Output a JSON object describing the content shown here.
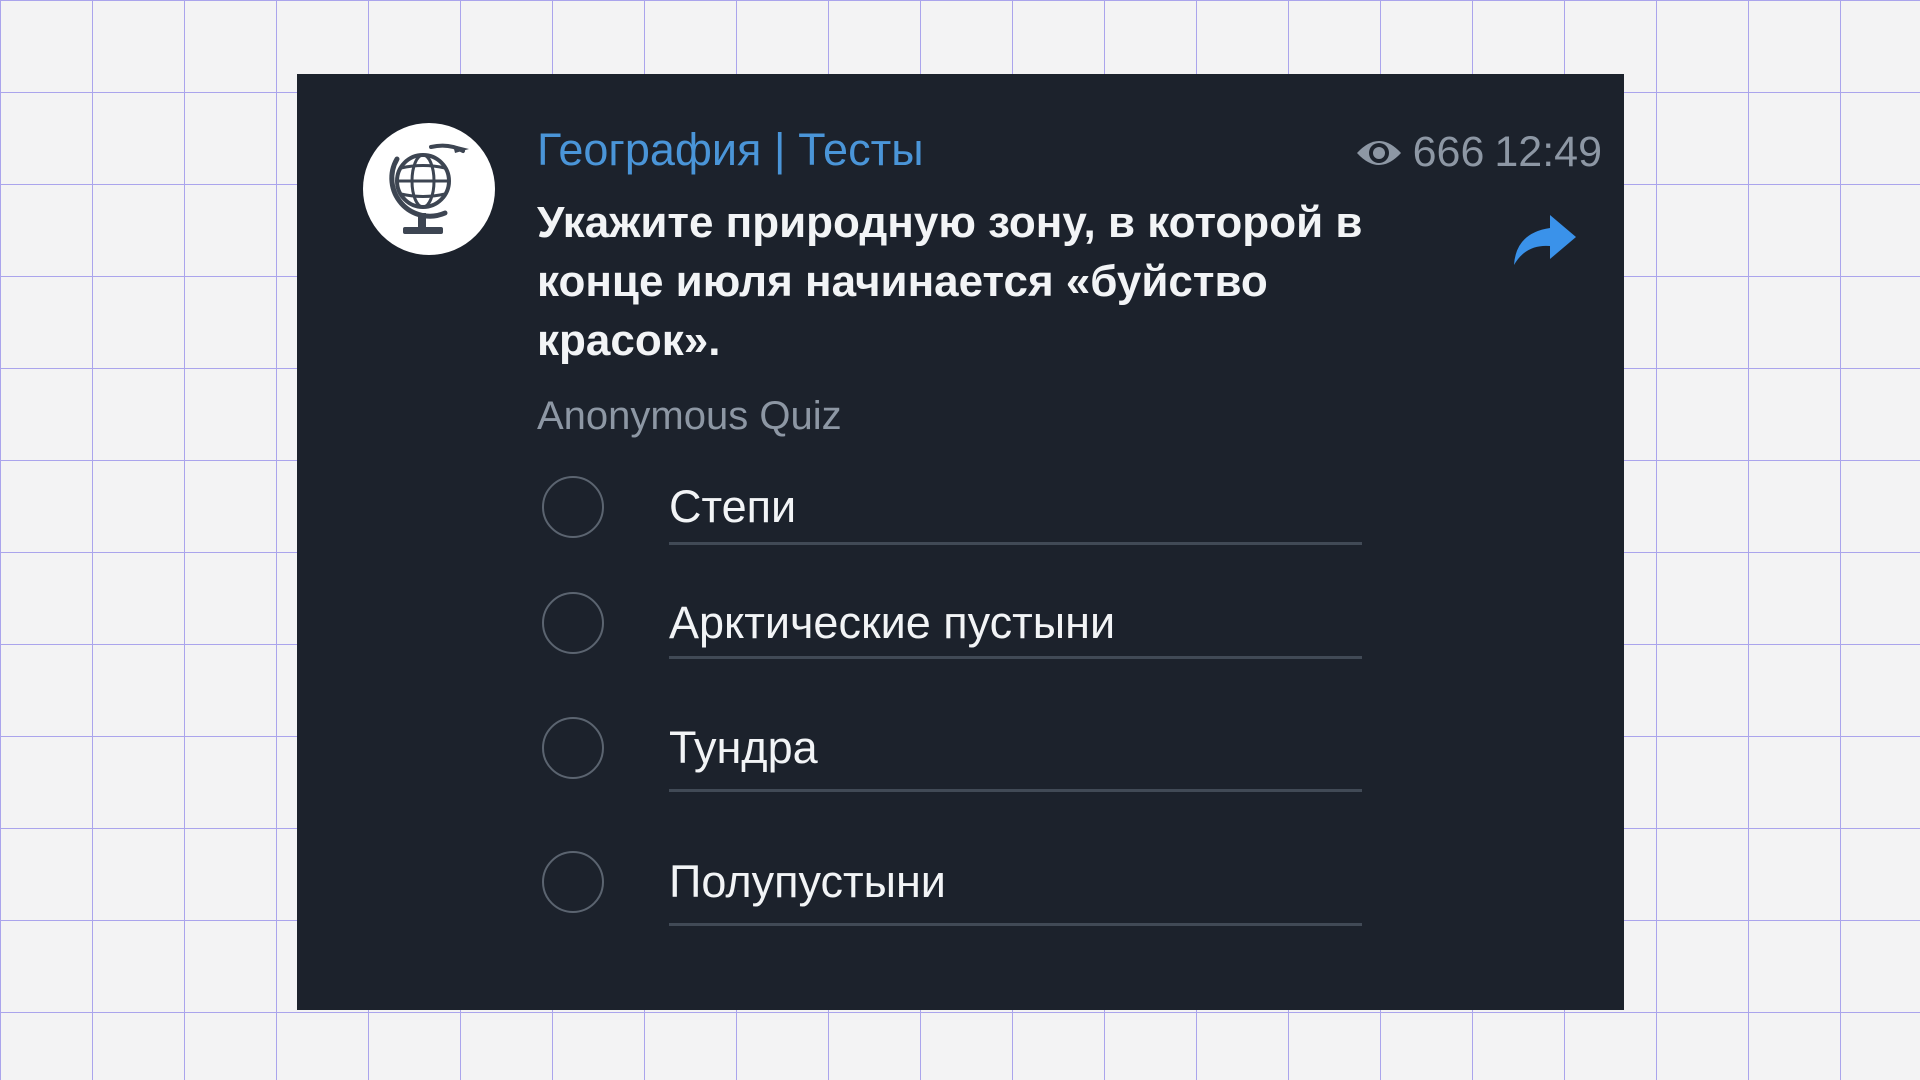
{
  "channel": {
    "name": "География | Тесты",
    "avatar_icon": "globe-icon"
  },
  "meta": {
    "views": "666",
    "time": "12:49",
    "views_icon": "eye-icon"
  },
  "post": {
    "question": "Укажите природную зону, в которой в конце июля начинается «буйство красок».",
    "share_icon": "share-icon"
  },
  "quiz": {
    "type_label": "Anonymous Quiz",
    "options": [
      {
        "label": "Степи"
      },
      {
        "label": "Арктические пустыни"
      },
      {
        "label": "Тундра"
      },
      {
        "label": "Полупустыни"
      }
    ]
  },
  "colors": {
    "card_background": "#1c222c",
    "channel_name": "#4a95d8",
    "share_icon": "#3a92ea",
    "page_background": "#f3f3f4",
    "grid_lines": "#aaa4ec"
  }
}
